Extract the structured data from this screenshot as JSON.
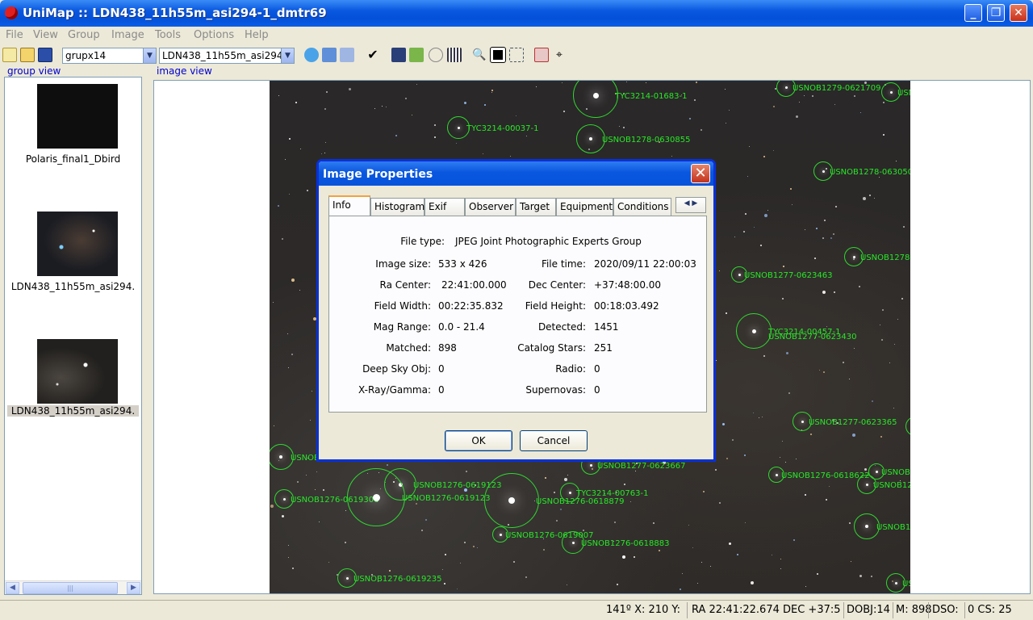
{
  "window": {
    "title": "UniMap :: LDN438_11h55m_asi294-1_dmtr69"
  },
  "menu": [
    "File",
    "View",
    "Group",
    "Image",
    "Tools",
    "Options",
    "Help"
  ],
  "toolbar": {
    "group_combo": "grupx14",
    "image_combo": "LDN438_11h55m_asi294-"
  },
  "panels": {
    "group_view": "group view",
    "image_view": "image view"
  },
  "group_items": [
    {
      "label": "Polaris_final1_Dbird"
    },
    {
      "label": "LDN438_11h55m_asi294."
    },
    {
      "label": "LDN438_11h55m_asi294."
    }
  ],
  "catalog_labels": [
    "TYC3214-01683-1",
    "TYC3214-00037-1",
    "USNOB1278-0630855",
    "USNOB1279-0621709",
    "USNOB1279-0621502",
    "USNOB1278-0630500",
    "USNOB1278-0630526",
    "USNOB1277-0623463",
    "TYC3214-00457-1",
    "USNOB1277-0623430",
    "USNOB1277-0623262",
    "USNOB1277-0623365",
    "USNOB1276-0618481",
    "USNOB1276-0618622",
    "USNOB1276-0618494",
    "USNOB1276-0619123",
    "USNOB1276-0619306",
    "USNOB1277-0623667",
    "TYC3214-00763-1",
    "USNOB1276-0618879",
    "USNOB1276-0618883",
    "USNOB1276-0618502",
    "USNOB1276-0619235",
    "USNOB1276-0618460",
    "USNOB1276-0619007",
    "USNOB1277-0624170"
  ],
  "dialog": {
    "title": "Image Properties",
    "tabs": [
      "Info",
      "Histogram",
      "Exif",
      "Observer",
      "Target",
      "Equipment",
      "Conditions"
    ],
    "file_type_label": "File type:",
    "file_type": "JPEG Joint Photographic Experts Group",
    "image_size_label": "Image size:",
    "image_size": "533 x 426",
    "file_time_label": "File time:",
    "file_time": "2020/09/11 22:00:03",
    "ra_label": "Ra Center:",
    "ra": "22:41:00.000",
    "dec_label": "Dec Center:",
    "dec": "+37:48:00.00",
    "fw_label": "Field Width:",
    "fw": "00:22:35.832",
    "fh_label": "Field Height:",
    "fh": "00:18:03.492",
    "mag_label": "Mag Range:",
    "mag": "0.0 - 21.4",
    "detected_label": "Detected:",
    "detected": "1451",
    "matched_label": "Matched:",
    "matched": "898",
    "catalog_label": "Catalog Stars:",
    "catalog": "251",
    "dso_label": "Deep Sky Obj:",
    "dso": "0",
    "radio_label": "Radio:",
    "radio": "0",
    "xray_label": "X-Ray/Gamma:",
    "xray": "0",
    "sn_label": "Supernovas:",
    "sn": "0",
    "ok": "OK",
    "cancel": "Cancel"
  },
  "status": {
    "s1": "141º X: 210 Y:",
    "s2": "RA  22:41:22.674 DEC +37:5",
    "s3": "DOBJ:14",
    "s4": "M: 898",
    "s5": "DSO:",
    "s6": "0 CS: 25"
  },
  "colors": {
    "title_blue": "#0A58E0",
    "overlay_green": "#2fd92f",
    "dialog_border": "#0831d9"
  }
}
